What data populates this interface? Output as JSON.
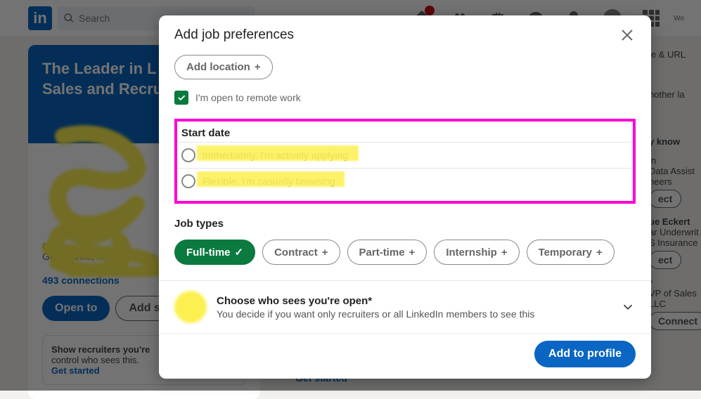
{
  "nav": {
    "search_placeholder": "Search",
    "work_label": "Wo"
  },
  "profile": {
    "headline1": "The Leader in L",
    "headline2": "Sales and Recru",
    "meta1": "als",
    "meta2": "Grasonville, Maryland, Un",
    "connections": "493 connections",
    "open_to": "Open to",
    "add_section": "Add se",
    "recruiter_line1": "Show recruiters you're",
    "recruiter_line2": "control who sees this.",
    "get_started": "Get started"
  },
  "right": {
    "edit": "le & URL",
    "lang": "nother la",
    "know": "y know",
    "p1a": "in",
    "p1b": "Data Assist",
    "p1c": "neers",
    "p2a": "ue Eckert",
    "p2b": "ar Underwrit",
    "p2c": "S Insurance",
    "p3a": "r",
    "p3b": "VP of Sales",
    "p3c": "LLC",
    "connect": "Connect",
    "ect": "ect"
  },
  "modal": {
    "title": "Add job preferences",
    "add_location": "Add location",
    "remote": "I'm open to remote work",
    "start_date": "Start date",
    "radio1": "Immediately, I'm actively applying",
    "radio2": "Flexible, I'm casually browsing",
    "job_types": "Job types",
    "types": {
      "fulltime": "Full-time",
      "contract": "Contract",
      "parttime": "Part-time",
      "internship": "Internship",
      "temporary": "Temporary"
    },
    "who_title": "Choose who sees you're open*",
    "who_sub": "You decide if you want only recruiters or all LinkedIn members to see this",
    "add_to_profile": "Add to profile"
  },
  "footer": {
    "get_started": "Get started"
  }
}
